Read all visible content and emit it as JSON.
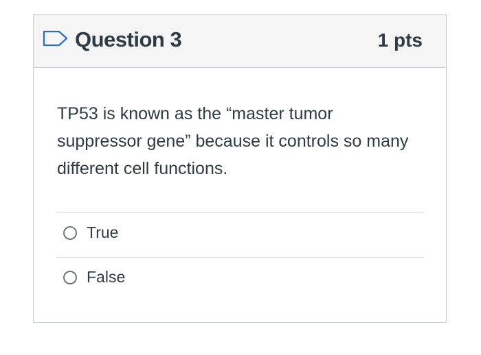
{
  "question": {
    "title": "Question 3",
    "points": "1 pts",
    "text": "TP53 is known as the “master tumor suppressor gene” because it controls so many different cell functions.",
    "flag_icon": "flag-outline-icon"
  },
  "answers": [
    {
      "label": "True",
      "selected": false
    },
    {
      "label": "False",
      "selected": false
    }
  ],
  "colors": {
    "header_bg": "#f5f5f5",
    "border": "#c7cdd1",
    "text": "#2d3b45",
    "flag": "#2c6fc1"
  }
}
